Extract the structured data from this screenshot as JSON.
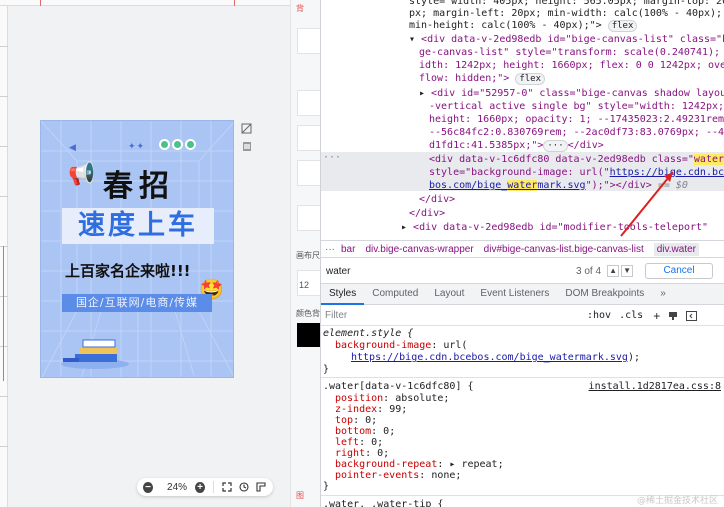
{
  "editor": {
    "poster": {
      "deco_left": "◀",
      "deco_mid": "✦✦",
      "title_line1": "春招",
      "title_line2": "速度上车",
      "subline": "上百家名企来啦!!!",
      "tags": "国企/互联网/电商/传媒",
      "megaphone": "📢",
      "smiley": "🤩"
    },
    "zoom": {
      "minus": "−",
      "value": "24%",
      "plus": "+"
    }
  },
  "midpanel": {
    "label_canvas": "画布尺",
    "label_num": "12",
    "label_color": "颜色背",
    "top_icon": "背",
    "bottom_icon": "图"
  },
  "devtools": {
    "elements": [
      "style=\"width: 405px; height: 565.05px; margin-top: 20",
      "px; margin-left: 20px; min-width: calc(100% - 40px);",
      "min-height: calc(100% - 40px);\">"
    ],
    "canvas_list": {
      "line1_a": "<div data-v-2ed98edb id=\"bige-canvas-list\" class=\"bi",
      "line1_b": "ge-canvas-list\" style=\"transform: scale(0.240741); w",
      "line1_c": "idth: 1242px; height: 1660px; flex: 0 0 1242px; over",
      "line1_d": "flow: hidden;\">"
    },
    "canvas_inner": {
      "a": "<div id=\"52957-0\" class=\"bige-canvas shadow layout",
      "b": "-vertical active single bg\" style=\"width: 1242px;",
      "c": "height: 1660px; opacity: 1; --17435023:2.49231rem;",
      "d": "--56c84fc2:0.830769rem; --2ac0df73:83.0769px; --4b",
      "e": "d1fd1c:41.5385px;\">",
      "f": "</div>"
    },
    "water_line": {
      "a1": "<div data-v-1c6dfc80 data-v-2ed98edb class=\"",
      "a2": "water",
      "a3": "\"",
      "b1": "style=\"background-image: url(\"",
      "b2": "https://bige.cdn.bce",
      "c1": "bos.com/bige_",
      "c2": "water",
      "c3": "mark.svg",
      "c4": "\");\"></div>",
      "c5": " == $0"
    },
    "close1": "</div>",
    "close2": "</div>",
    "modifier": "<div data-v-2ed98edb id=\"modifier-tools-teleport\"",
    "flex_pill": "flex",
    "breadcrumbs": [
      "bar",
      "div.bige-canvas-wrapper",
      "div#bige-canvas-list.bige-canvas-list",
      "div.water"
    ],
    "search": {
      "query": "water",
      "count": "3 of 4",
      "up": "▲",
      "down": "▼",
      "cancel": "Cancel"
    },
    "tabs": [
      "Styles",
      "Computed",
      "Layout",
      "Event Listeners",
      "DOM Breakpoints",
      "»"
    ],
    "filter": {
      "placeholder": "Filter",
      "hov": ":hov",
      "cls": ".cls",
      "plus": "+"
    },
    "styles": {
      "element_style": "element.style {",
      "bg_prop": "background-image",
      "bg_val_pre": "url(",
      "bg_url": "https://bige.cdn.bcebos.com/bige_watermark.svg",
      "bg_val_post": ");",
      "close": "}",
      "water_selector": ".water[data-v-1c6dfc80] {",
      "water_src": "install.1d2817ea.css:8",
      "props": [
        {
          "k": "position",
          "v": "absolute;"
        },
        {
          "k": "z-index",
          "v": "99;"
        },
        {
          "k": "top",
          "v": "0;"
        },
        {
          "k": "bottom",
          "v": "0;"
        },
        {
          "k": "left",
          "v": "0;"
        },
        {
          "k": "right",
          "v": "0;"
        },
        {
          "k": "background-repeat",
          "v": "▸ repeat;"
        },
        {
          "k": "pointer-events",
          "v": "none;"
        }
      ],
      "last_line": ".water, .water-tip {"
    },
    "watermark": "@稀土掘金技术社区"
  }
}
